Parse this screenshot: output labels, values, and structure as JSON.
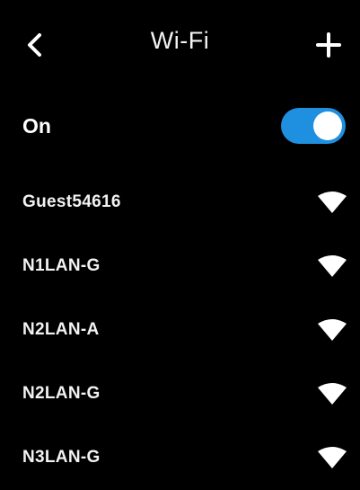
{
  "header": {
    "title": "Wi-Fi",
    "back_icon": "chevron-left-icon",
    "add_icon": "plus-icon"
  },
  "wifi_toggle": {
    "label": "On",
    "state": "on",
    "accent_color": "#1f8fe0"
  },
  "networks": [
    {
      "ssid": "Guest54616",
      "icon": "wifi-signal-icon"
    },
    {
      "ssid": "N1LAN-G",
      "icon": "wifi-signal-icon"
    },
    {
      "ssid": "N2LAN-A",
      "icon": "wifi-signal-icon"
    },
    {
      "ssid": "N2LAN-G",
      "icon": "wifi-signal-icon"
    },
    {
      "ssid": "N3LAN-G",
      "icon": "wifi-signal-icon"
    }
  ]
}
